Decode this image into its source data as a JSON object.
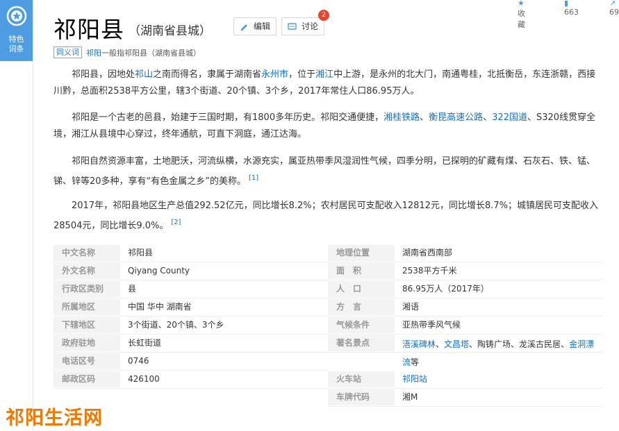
{
  "sidebar": {
    "badge_label_line1": "特色",
    "badge_label_line2": "词条"
  },
  "topbar": {
    "favorite_label": "收藏",
    "like_count": "663",
    "share_count": "69"
  },
  "header": {
    "title": "祁阳县",
    "subtitle": "（湖南省县城）",
    "edit_label": "编辑",
    "discuss_label": "讨论",
    "discuss_count": "2"
  },
  "synonym": {
    "tag": "同义词",
    "link": "祁阳",
    "text": "一般指祁阳县（湖南省县城）"
  },
  "paragraphs": {
    "p1": {
      "a": "祁阳县，因地处",
      "link1": "祁山",
      "b": "之南而得名，隶属于湖南省",
      "link2": "永州市",
      "c": "，位于",
      "link3": "湘江",
      "d": "中上游，是永州的北大门，南通粤桂，北抵衡岳，东连浙赣，西接川黔，总面积2538平方公里，辖3个街道、20个镇、3个乡，2017年常住人口86.95万人。"
    },
    "p2": {
      "a": "祁阳是一个古老的邑县，始建于三国时期，有1800多年历史。祁阳交通便捷，",
      "link1": "湘桂铁路",
      "sep1": "、",
      "link2": "衡昆高速公路",
      "sep2": "、",
      "link3": "322国道",
      "b": "、S320线贯穿全境，湘江从县境中心穿过，终年通航，可直下洞庭，通江达海。"
    },
    "p3": {
      "text": "祁阳自然资源丰富，土地肥沃，河流纵横，水源充实，属亚热带季风湿润性气候，四季分明，已探明的矿藏有煤、石灰石、铁、锰、锑、锌等20多种，享有“有色金属之乡”的美称。",
      "ref": "[1]"
    },
    "p4": {
      "text": "2017年，祁阳县地区生产总值292.52亿元，同比增长8.2%；农村居民可支配收入12812元，同比增长8.7%；城镇居民可支配收入28504元，同比增长9.0%。",
      "ref": "[2]"
    }
  },
  "infobox": {
    "left": [
      {
        "label": "中文名称",
        "value": "祁阳县"
      },
      {
        "label": "外文名称",
        "value": "Qiyang County"
      },
      {
        "label": "行政区类别",
        "value": "县"
      },
      {
        "label": "所属地区",
        "value": "中国 华中 湖南省"
      },
      {
        "label": "下辖地区",
        "value": "3个街道、20个镇、3个乡"
      },
      {
        "label": "政府驻地",
        "value": "长虹街道"
      },
      {
        "label": "电话区号",
        "value": "0746"
      },
      {
        "label": "邮政区码",
        "value": "426100"
      }
    ],
    "right": [
      {
        "label": "地理位置",
        "value": "湖南省西南部"
      },
      {
        "label": "面　积",
        "value": "2538平方千米"
      },
      {
        "label": "人　口",
        "value": "86.95万人（2017年）"
      },
      {
        "label": "方　言",
        "value": "湘语"
      },
      {
        "label": "气候条件",
        "value": "亚热带季风气候"
      },
      {
        "label": "著名景点",
        "link1": "浯溪碑林",
        "sep1": "、",
        "link2": "文昌塔",
        "mid": "、陶铸广场、龙溪古民居、",
        "link3": "金洞漂流",
        "tail": "等"
      },
      {
        "label": "火车站",
        "value": "祁阳站"
      },
      {
        "label": "车牌代码",
        "value": "湘M"
      }
    ]
  },
  "watermark": "祁阳生活网",
  "colors": {
    "accent": "#4e9de3",
    "link": "#136ec2",
    "badge": "#e4452e",
    "watermark": "#f07800"
  }
}
